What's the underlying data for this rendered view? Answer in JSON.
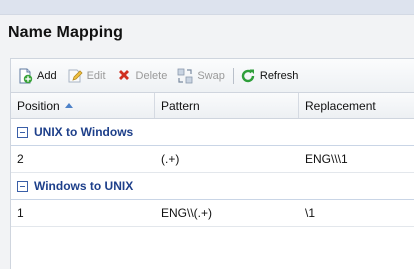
{
  "page": {
    "title": "Name Mapping"
  },
  "toolbar": {
    "add_label": "Add",
    "edit_label": "Edit",
    "delete_label": "Delete",
    "swap_label": "Swap",
    "refresh_label": "Refresh"
  },
  "table": {
    "columns": [
      "Position",
      "Pattern",
      "Replacement"
    ],
    "sort_column": "Position",
    "sort_direction": "ascending",
    "groups": [
      {
        "label": "UNIX to Windows",
        "rows": [
          {
            "position": "2",
            "pattern": "(.+)",
            "replacement": "ENG\\\\\\1"
          }
        ]
      },
      {
        "label": "Windows to UNIX",
        "rows": [
          {
            "position": "1",
            "pattern": "ENG\\\\(.+)",
            "replacement": "\\1"
          }
        ]
      }
    ]
  },
  "icons": {
    "add": "add-icon",
    "edit": "edit-icon",
    "delete": "delete-icon",
    "swap": "swap-icon",
    "refresh": "refresh-icon"
  },
  "colors": {
    "group_text": "#1d3f8a",
    "sort_arrow": "#4e82c8",
    "refresh_green": "#2e9e3a",
    "delete_red": "#d03020"
  }
}
